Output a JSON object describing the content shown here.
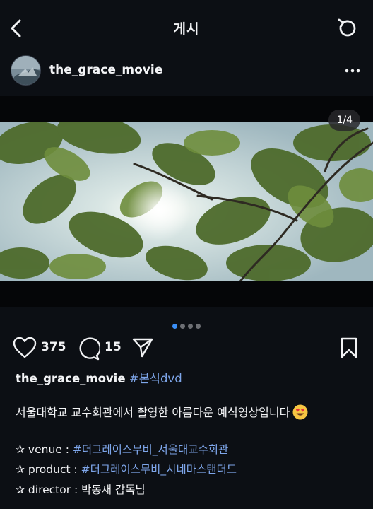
{
  "header": {
    "title": "게시",
    "back_icon": "chevron-left-icon",
    "refresh_icon": "refresh-icon"
  },
  "post": {
    "username": "the_grace_movie",
    "more_icon": "more-horizontal-icon",
    "media_counter": "1/4",
    "carousel": {
      "total": 4,
      "active_index": 0
    }
  },
  "actions": {
    "likes": "375",
    "comments": "15"
  },
  "caption": {
    "username": "the_grace_movie",
    "hashtag": "#본식dvd",
    "text": "서울대학교 교수회관에서 촬영한 아름다운 예식영상입니다",
    "emoji": "heart-eyes-emoji",
    "lines": [
      {
        "label": " venue : ",
        "value": "#더그레이스무비_서울대교수회관",
        "value_is_tag": true
      },
      {
        "label": " product : ",
        "value": "#더그레이스무비_시네마스탠더드",
        "value_is_tag": true
      },
      {
        "label": " director : ",
        "value": "박동재 감독님",
        "value_is_tag": false
      }
    ]
  },
  "colors": {
    "background": "#0c0f14",
    "hashtag": "#7ea6ea",
    "dot_active": "#3a8ef6",
    "dot_inactive": "#6d6f74"
  }
}
